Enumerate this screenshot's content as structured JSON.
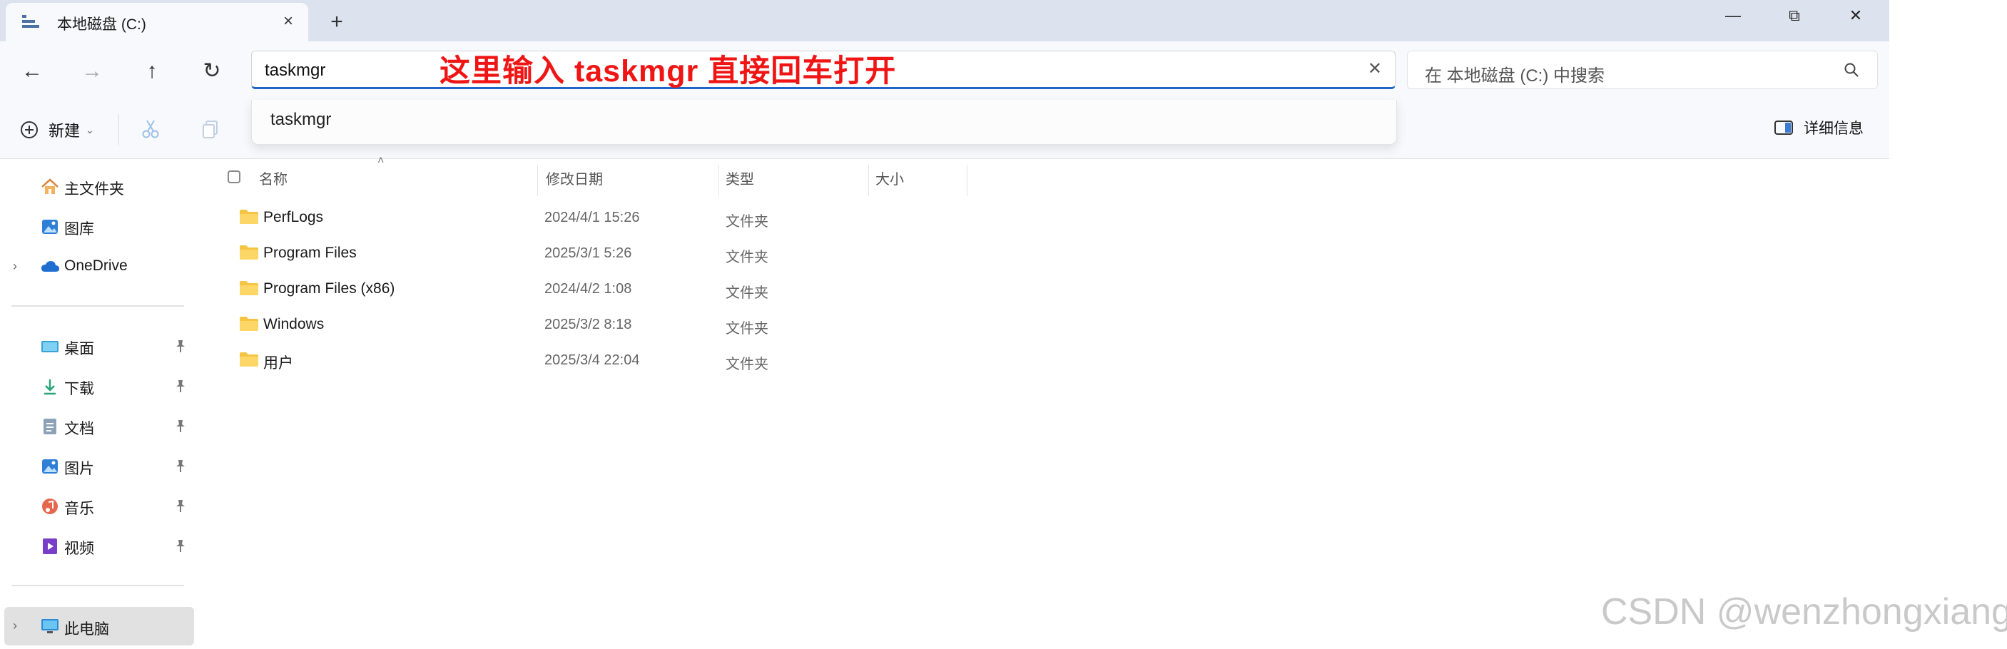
{
  "window": {
    "tab_title": "本地磁盘 (C:)",
    "tab_close": "×",
    "new_tab": "+",
    "minimize": "—",
    "restore": "⧉",
    "close": "✕"
  },
  "nav": {
    "back": "←",
    "forward": "→",
    "up": "↑",
    "refresh": "↻",
    "address_value": "taskmgr",
    "address_clear": "✕",
    "search_placeholder": "在 本地磁盘 (C:) 中搜索"
  },
  "annotation": "这里输入  taskmgr 直接回车打开",
  "toolbar": {
    "new_label": "新建",
    "new_caret": "⌄",
    "details_label": "详细信息"
  },
  "suggestions": [
    "taskmgr"
  ],
  "sidebar": {
    "top_items": [
      {
        "label": "主文件夹",
        "icon": "home-icon"
      },
      {
        "label": "图库",
        "icon": "gallery-icon"
      },
      {
        "label": "OneDrive",
        "icon": "cloud-icon",
        "chevron": "›"
      }
    ],
    "pinned_items": [
      {
        "label": "桌面",
        "icon": "desktop-icon"
      },
      {
        "label": "下载",
        "icon": "download-icon"
      },
      {
        "label": "文档",
        "icon": "document-icon"
      },
      {
        "label": "图片",
        "icon": "pictures-icon"
      },
      {
        "label": "音乐",
        "icon": "music-icon"
      },
      {
        "label": "视频",
        "icon": "video-icon"
      }
    ],
    "this_pc": {
      "label": "此电脑",
      "icon": "computer-icon",
      "chevron": "›"
    }
  },
  "columns": {
    "name": "名称",
    "date": "修改日期",
    "type": "类型",
    "size": "大小",
    "sort_arrow": "˄"
  },
  "files": [
    {
      "name": "PerfLogs",
      "date": "2024/4/1 15:26",
      "type": "文件夹"
    },
    {
      "name": "Program Files",
      "date": "2025/3/1 5:26",
      "type": "文件夹"
    },
    {
      "name": "Program Files (x86)",
      "date": "2024/4/2 1:08",
      "type": "文件夹"
    },
    {
      "name": "Windows",
      "date": "2025/3/2 8:18",
      "type": "文件夹"
    },
    {
      "name": "用户",
      "date": "2025/3/4 22:04",
      "type": "文件夹"
    }
  ],
  "watermark": "CSDN @wenzhongxiang",
  "colors": {
    "accent": "#1f65c8",
    "annotation": "#f01515",
    "folder": "#f4c442",
    "titlebar": "#dde3ee"
  }
}
